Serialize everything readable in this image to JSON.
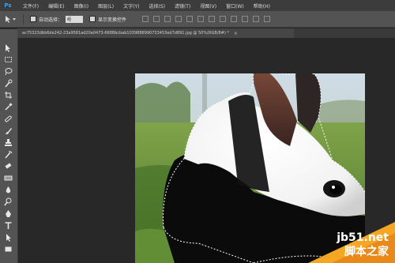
{
  "app": {
    "logo": "Ps"
  },
  "menu": [
    "文件(F)",
    "编辑(E)",
    "图像(I)",
    "图层(L)",
    "文字(Y)",
    "选择(S)",
    "滤镜(T)",
    "视图(V)",
    "窗口(W)",
    "帮助(H)"
  ],
  "options": {
    "auto_select_label": "自动选择：",
    "auto_select_value": "组",
    "show_transform_label": "显示变换控件"
  },
  "document": {
    "tab_title": "ac75323dbb6de242-23a9581ad20a0473-6688bcbab1039888990733453ed7d891.jpg @ 50%(RGB/8#) *",
    "close": "×"
  },
  "watermark": {
    "site": "jb51.net",
    "name": "脚本之家"
  },
  "colors": {
    "accent": "#31a8ff",
    "panel": "#535353",
    "workspace": "#282828"
  }
}
